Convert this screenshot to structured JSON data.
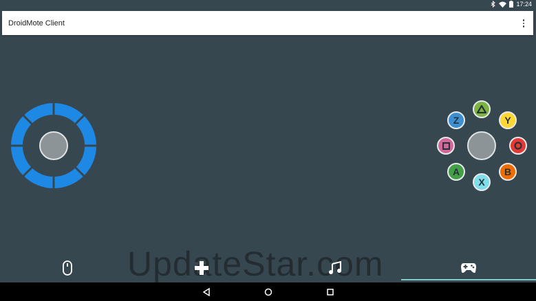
{
  "status_bar": {
    "time": "17:24",
    "icons": [
      "bluetooth-icon",
      "wifi-icon",
      "battery-icon"
    ]
  },
  "toolbar": {
    "title": "DroidMote Client",
    "menu_icon": "overflow-menu-icon"
  },
  "joystick": {
    "color": "#1e88e5",
    "knob_color": "#8d9497"
  },
  "gamepad": {
    "buttons": [
      {
        "name": "triangle",
        "label": "",
        "color": "#7cb342"
      },
      {
        "name": "z",
        "label": "Z",
        "color": "#3d8fd1"
      },
      {
        "name": "y",
        "label": "Y",
        "color": "#fdd835"
      },
      {
        "name": "square",
        "label": "",
        "color": "#d1679a"
      },
      {
        "name": "circle",
        "label": "",
        "color": "#e53935"
      },
      {
        "name": "a",
        "label": "A",
        "color": "#43a047"
      },
      {
        "name": "b",
        "label": "B",
        "color": "#ef6c00"
      },
      {
        "name": "x",
        "label": "X",
        "color": "#80deea"
      }
    ]
  },
  "bottom_tabs": [
    "mouse-icon",
    "dpad-icon",
    "music-icon",
    "gamepad-icon"
  ],
  "active_tab": "gamepad-icon",
  "accent_color": "#80cbc4",
  "watermark": "UpdateStar.com",
  "nav_bar": [
    "back-icon",
    "home-icon",
    "recents-icon"
  ]
}
